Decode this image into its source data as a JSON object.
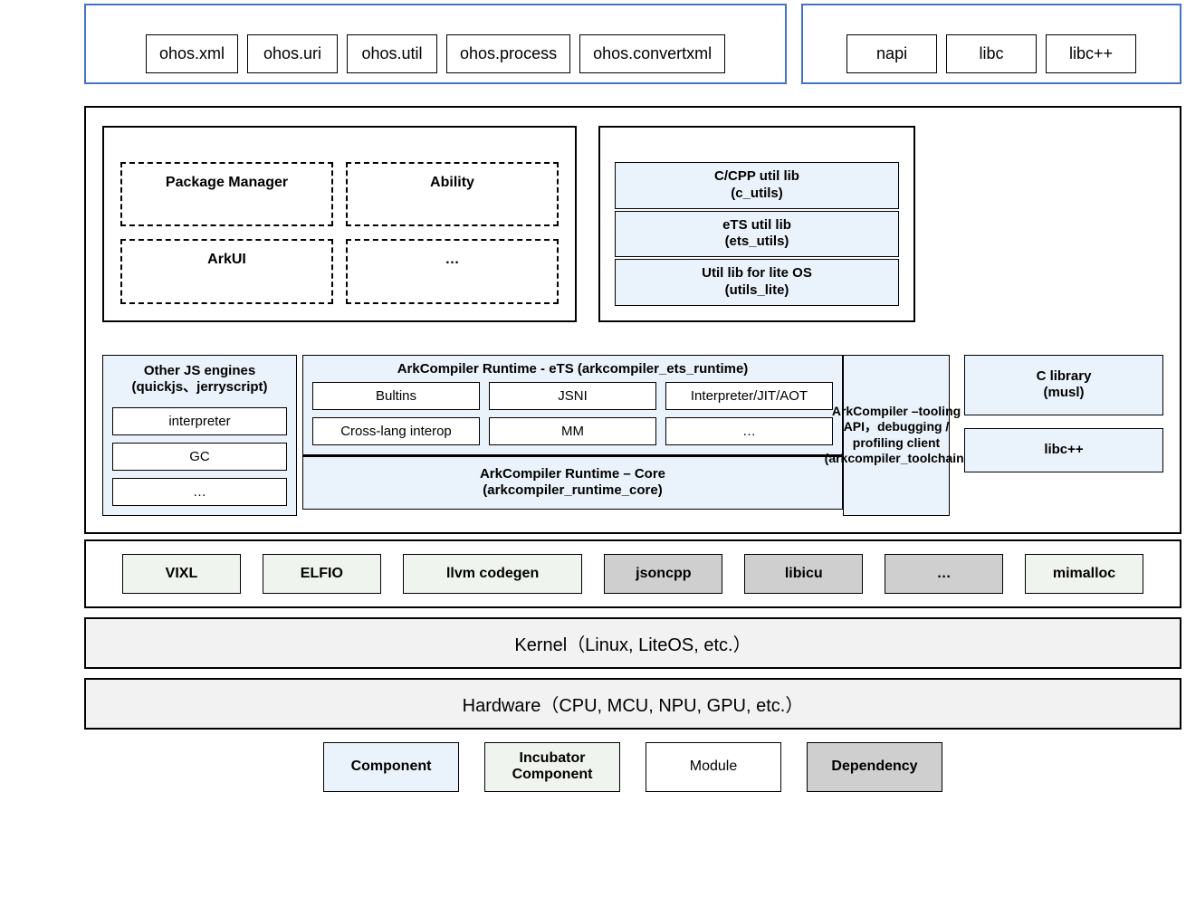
{
  "top": {
    "left": [
      "ohos.xml",
      "ohos.uri",
      "ohos.util",
      "ohos.process",
      "ohos.convertxml"
    ],
    "right": [
      "napi",
      "libc",
      "libc++"
    ]
  },
  "frameworks": {
    "items": [
      "Package Manager",
      "Ability",
      "ArkUI",
      "…"
    ]
  },
  "commons": {
    "items": [
      {
        "name": "C/CPP util lib",
        "sub": "(c_utils)"
      },
      {
        "name": "eTS util lib",
        "sub": "(ets_utils)"
      },
      {
        "name": "Util lib for lite OS",
        "sub": "(utils_lite)"
      }
    ]
  },
  "runtime": {
    "other_engines": {
      "title": "Other JS engines\n(quickjs、jerryscript)",
      "modules": [
        "interpreter",
        "GC",
        "…"
      ]
    },
    "ark_ets": {
      "title": "ArkCompiler Runtime - eTS  (arkcompiler_ets_runtime)",
      "modules": [
        "Bultins",
        "JSNI",
        "Interpreter/JIT/AOT",
        "Cross-lang interop",
        "MM",
        "…"
      ]
    },
    "ark_core": "ArkCompiler Runtime – Core\n(arkcompiler_runtime_core)",
    "tooling": "ArkCompiler –tooling API，debugging / profiling client (arkcompiler_toolchain)",
    "c_library": "C library\n(musl)",
    "libcpp": "libc++"
  },
  "deps": {
    "incubator": [
      "VIXL",
      "ELFIO",
      "llvm codegen",
      "mimalloc"
    ],
    "dependency": [
      "jsoncpp",
      "libicu",
      "…"
    ]
  },
  "kernel": "Kernel（Linux, LiteOS, etc.）",
  "hardware": "Hardware（CPU, MCU, NPU, GPU, etc.）",
  "legend": {
    "component": "Component",
    "incubator": "Incubator\nComponent",
    "module": "Module",
    "dependency": "Dependency"
  }
}
